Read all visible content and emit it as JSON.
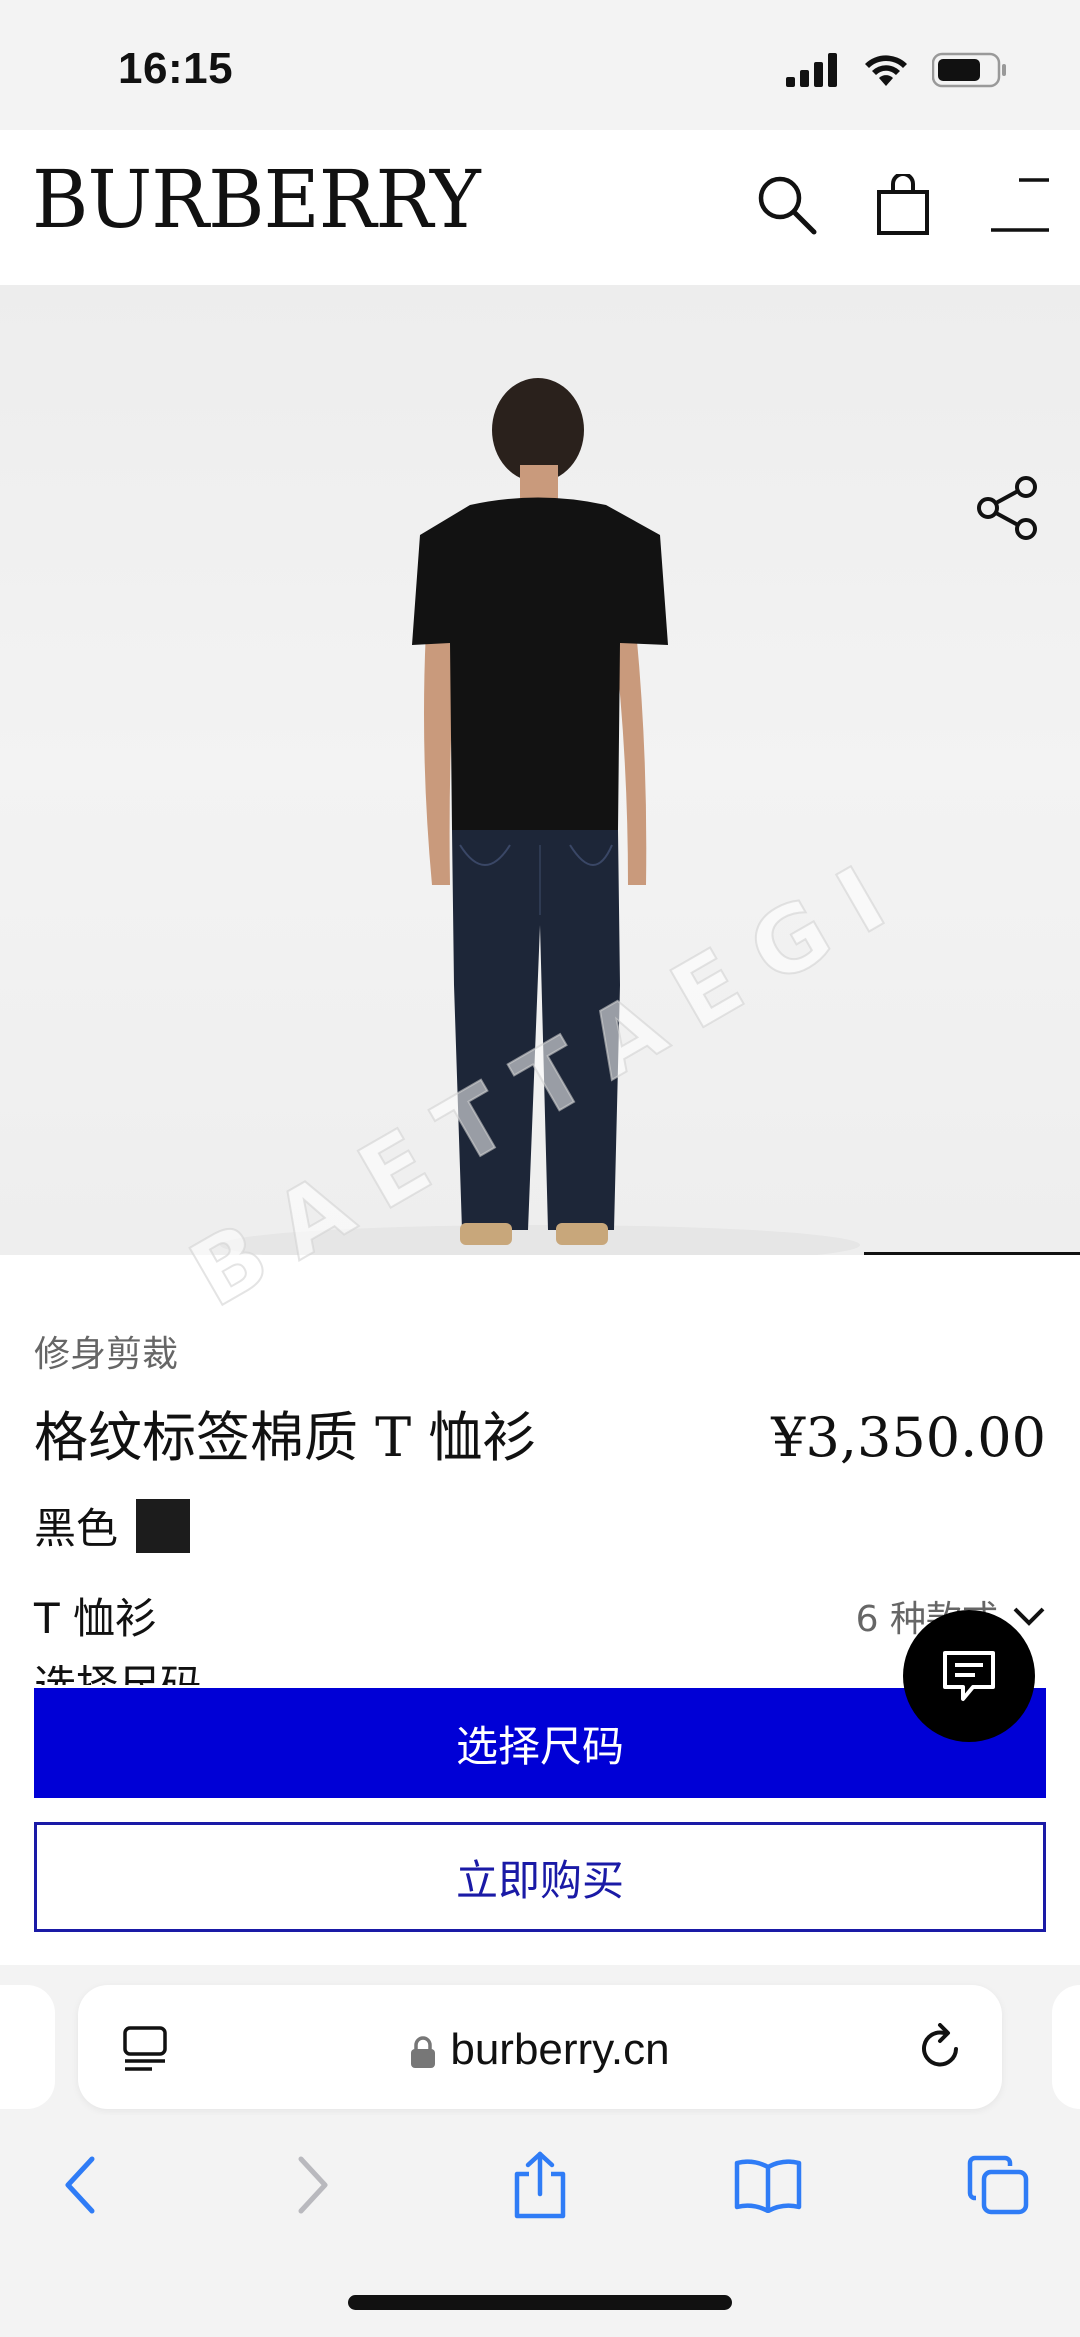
{
  "status": {
    "time": "16:15"
  },
  "header": {
    "logo": "BURBERRY",
    "icons": [
      "search-icon",
      "shopping-bag-icon",
      "menu-icon"
    ]
  },
  "product": {
    "watermark": "BAETTAEGI",
    "fit": "修身剪裁",
    "name": "格纹标签棉质 T 恤衫",
    "price": "¥3,350.00",
    "color_label": "黑色",
    "color_swatch": "#1c1c1c",
    "style_label": "T 恤衫",
    "style_count": "6 种款式",
    "select_size_partial": "选择尺码"
  },
  "actions": {
    "select_size": "选择尺码",
    "buy_now": "立即购买"
  },
  "browser": {
    "url": "burberry.cn"
  },
  "colors": {
    "primary": "#0000d6",
    "secondary_border": "#1a1aa6",
    "safari_blue": "#2f7cf6"
  }
}
